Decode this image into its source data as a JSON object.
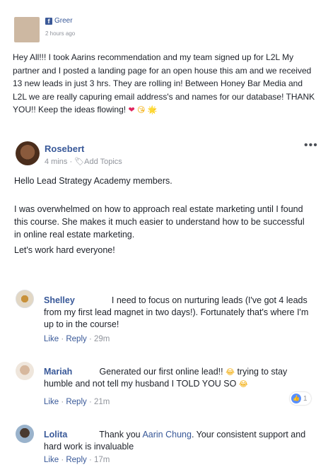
{
  "post1": {
    "author": "Greer",
    "time": "2 hours ago",
    "body": "Hey All!!! I took Aarins recommendation and my team signed up for L2L                    My partner and I posted a landing page for an open house this am and we received 13 new leads in just 3 hrs. They are rolling in! Between Honey Bar Media and L2L we are really capuring email address's and names for our database! THANK YOU!! Keep the ideas flowing!",
    "emojis": [
      "❤",
      "😘",
      "🌟"
    ]
  },
  "post2": {
    "author": "Rosebert",
    "time": "4 mins",
    "tag_label": "Add Topics",
    "menu": "•••",
    "paragraph1": "Hello Lead Strategy Academy members.",
    "paragraph2": "I was overwhelmed on how to approach real estate marketing until I found this course. She makes it much easier to understand how to be successful in online real estate marketing.",
    "paragraph3": "Let's work hard everyone!"
  },
  "comments": [
    {
      "author": "Shelley",
      "text": "I need to focus on nurturing leads (I've got 4 leads from my first lead magnet in two days!). Fortunately that's where I'm up to in the course!",
      "like": "Like",
      "reply": "Reply",
      "time": "29m"
    },
    {
      "author": "Mariah",
      "text_a": "Generated our first online lead!!",
      "text_b": "trying to stay humble and not tell my husband I TOLD YOU SO",
      "like": "Like",
      "reply": "Reply",
      "time": "21m",
      "reaction_count": "1"
    },
    {
      "author": "Lolita",
      "text_a": "Thank you",
      "mention": "Aarin Chung",
      "text_b": ". Your consistent support and hard work is invaluable",
      "like": "Like",
      "reply": "Reply",
      "time": "17m"
    }
  ],
  "colors": {
    "link": "#385898",
    "meta": "#90949c",
    "text": "#1d2129",
    "facebook_blue": "#3b5998",
    "like_blue": "#5890ff"
  }
}
